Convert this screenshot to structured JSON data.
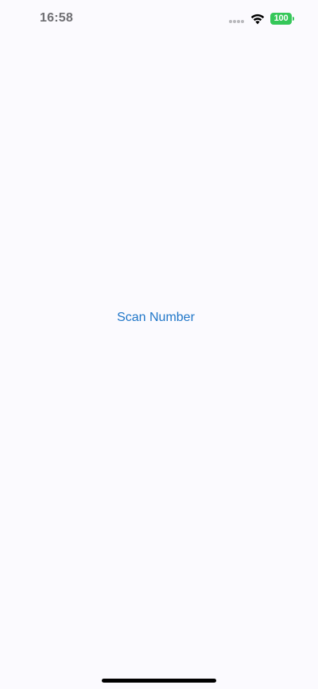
{
  "status_bar": {
    "time": "16:58",
    "battery_level": "100",
    "icons": [
      "signal-icon",
      "wifi-icon",
      "battery-icon"
    ],
    "battery_color": "#35c759"
  },
  "main": {
    "scan_button_label": "Scan Number",
    "accent_color": "#1f76c8"
  }
}
